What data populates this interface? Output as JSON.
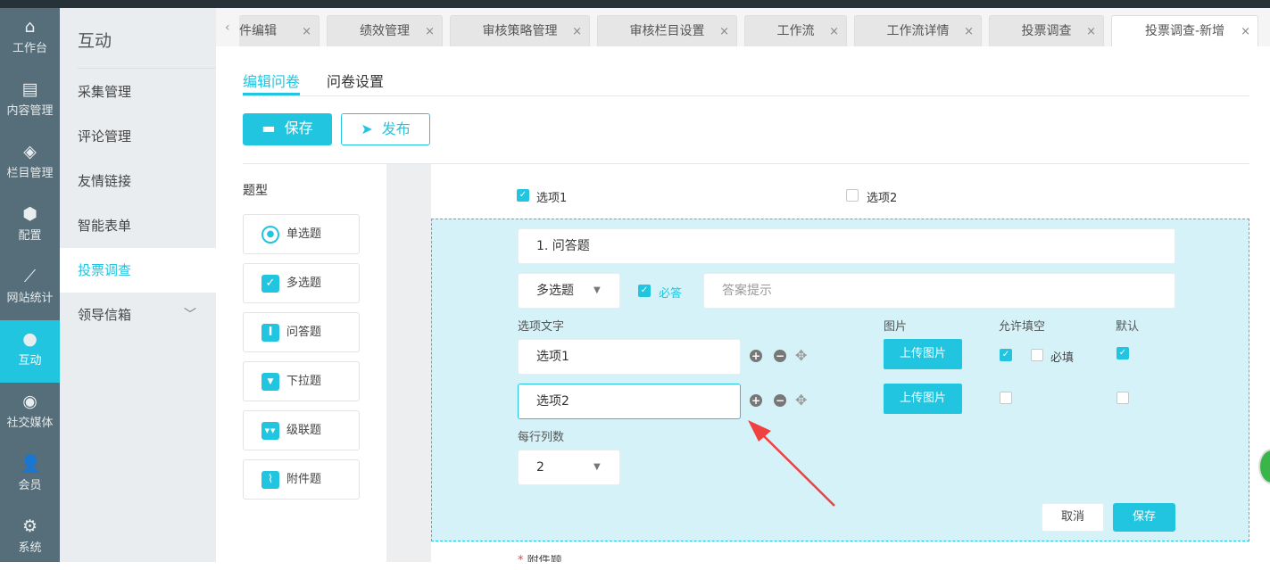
{
  "rail": [
    {
      "label": "工作台",
      "icon": "home-icon"
    },
    {
      "label": "内容管理",
      "icon": "document-icon"
    },
    {
      "label": "栏目管理",
      "icon": "layers-icon"
    },
    {
      "label": "配置",
      "icon": "cube-icon"
    },
    {
      "label": "网站统计",
      "icon": "chart-icon"
    },
    {
      "label": "互动",
      "icon": "chat-icon"
    },
    {
      "label": "社交媒体",
      "icon": "orbit-icon"
    },
    {
      "label": "会员",
      "icon": "user-icon"
    },
    {
      "label": "系统",
      "icon": "gear-icon"
    }
  ],
  "submenu": {
    "title": "互动",
    "items": [
      "采集管理",
      "评论管理",
      "友情链接",
      "智能表单",
      "投票调查",
      "领导信箱"
    ]
  },
  "tabs": [
    "件编辑",
    "绩效管理",
    "审核策略管理",
    "审核栏目设置",
    "工作流",
    "工作流详情",
    "投票调查",
    "投票调查-新增"
  ],
  "content_tabs": [
    "编辑问卷",
    "问卷设置"
  ],
  "toolbar": {
    "save": "保存",
    "publish": "发布"
  },
  "question_types": {
    "title": "题型",
    "items": [
      "单选题",
      "多选题",
      "问答题",
      "下拉题",
      "级联题",
      "附件题"
    ]
  },
  "preview_options": [
    "选项1",
    "选项2"
  ],
  "editor": {
    "title_value": "1. 问答题",
    "type_value": "多选题",
    "required_label": "必答",
    "hint_placeholder": "答案提示",
    "col_option_text": "选项文字",
    "col_image": "图片",
    "col_allow_fill": "允许填空",
    "col_default": "默认",
    "options": [
      "选项1",
      "选项2"
    ],
    "upload": "上传图片",
    "must_fill": "必填",
    "per_row_label": "每行列数",
    "per_row_value": "2",
    "cancel": "取消",
    "save": "保存"
  },
  "next_question": "附件题",
  "colors": {
    "accent": "#22c5e0",
    "rail": "#566e7a",
    "editor_bg": "#d4f2f7",
    "annotation_arrow": "#f04040"
  }
}
